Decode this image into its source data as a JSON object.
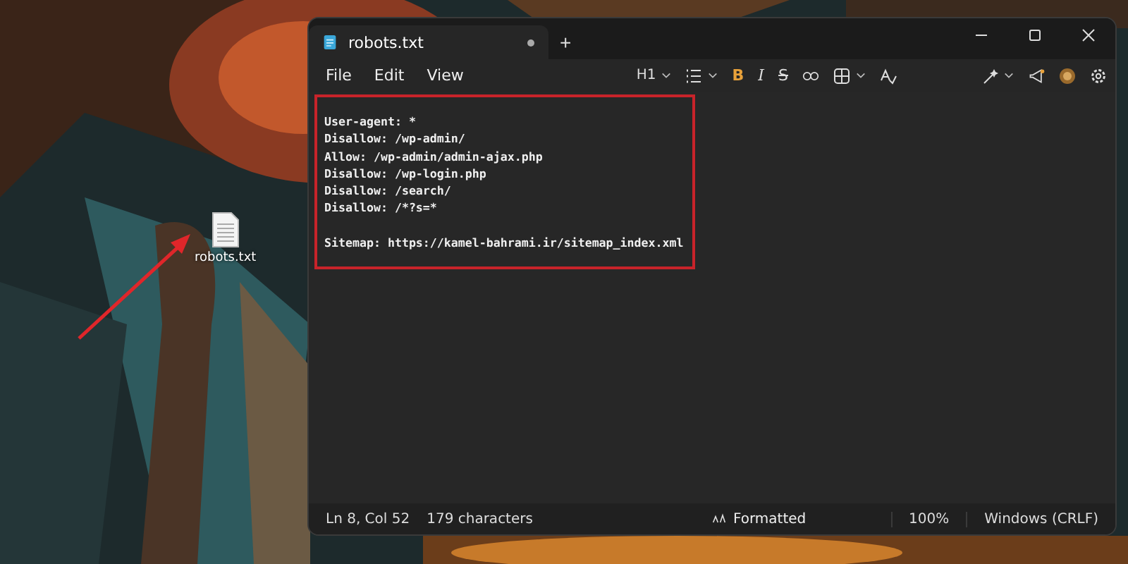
{
  "desktop": {
    "icons": [
      {
        "label": "robots.txt"
      }
    ]
  },
  "window": {
    "tab": {
      "title": "robots.txt",
      "unsaved": true
    },
    "new_tab": "+"
  },
  "menu": [
    "File",
    "Edit",
    "View"
  ],
  "toolbar": {
    "heading": "H1",
    "bold": "B",
    "italic": "I",
    "strike": "S"
  },
  "editor": {
    "highlighted": true,
    "paragraphs": [
      [
        "User-agent: *",
        "Disallow: /wp-admin/",
        "Allow: /wp-admin/admin-ajax.php",
        "Disallow: /wp-login.php",
        "Disallow: /search/",
        "Disallow: /*?s=*"
      ],
      [
        "Sitemap: https://kamel-bahrami.ir/sitemap_index.xml"
      ]
    ]
  },
  "status_bar": {
    "position": "Ln 8, Col 52",
    "characters": "179 characters",
    "format": "Formatted",
    "zoom": "100%",
    "line_ending": "Windows (CRLF)"
  }
}
